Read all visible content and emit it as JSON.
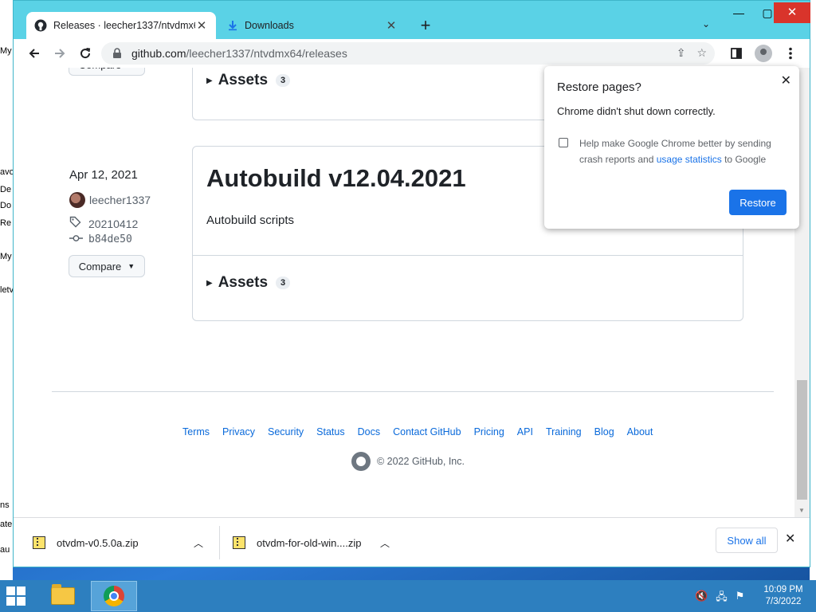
{
  "desktop": {
    "left_fragments": [
      "My",
      "avo",
      "De",
      "Do",
      "Re",
      "My",
      "letv",
      "ns",
      "ate",
      "au"
    ]
  },
  "browser": {
    "tabs": [
      {
        "title": "Releases · leecher1337/ntvdmx64",
        "icon": "github-icon",
        "active": true
      },
      {
        "title": "Downloads",
        "icon": "download-icon",
        "active": false
      }
    ],
    "new_tab_symbol": "+",
    "tab_search_symbol": "⌄",
    "url_host": "github.com",
    "url_path": "/leecher1337/ntvdmx64/releases"
  },
  "page": {
    "top_release": {
      "assets_label": "Assets",
      "assets_count": "3"
    },
    "release": {
      "date": "Apr 12, 2021",
      "author": "leecher1337",
      "tag": "20210412",
      "commit": "b84de50",
      "compare_label": "Compare",
      "title": "Autobuild v12.04.2021",
      "body": "Autobuild scripts",
      "assets_label": "Assets",
      "assets_count": "3"
    },
    "footer": {
      "links": [
        "Terms",
        "Privacy",
        "Security",
        "Status",
        "Docs",
        "Contact GitHub",
        "Pricing",
        "API",
        "Training",
        "Blog",
        "About"
      ],
      "copyright": "© 2022 GitHub, Inc."
    }
  },
  "restore_bubble": {
    "title": "Restore pages?",
    "message": "Chrome didn't shut down correctly.",
    "help_prefix": "Help make Google Chrome better by sending crash reports and ",
    "help_link": "usage statistics",
    "help_suffix": " to Google",
    "button": "Restore"
  },
  "downloads": {
    "items": [
      {
        "name": "otvdm-v0.5.0a.zip"
      },
      {
        "name": "otvdm-for-old-win....zip"
      }
    ],
    "show_all": "Show all"
  },
  "taskbar": {
    "time": "10:09 PM",
    "date": "7/3/2022"
  },
  "colors": {
    "chrome_frame": "#5ad2e6",
    "link_blue": "#0969da",
    "restore_button": "#1a73e8",
    "taskbar": "#2d7fbf"
  }
}
